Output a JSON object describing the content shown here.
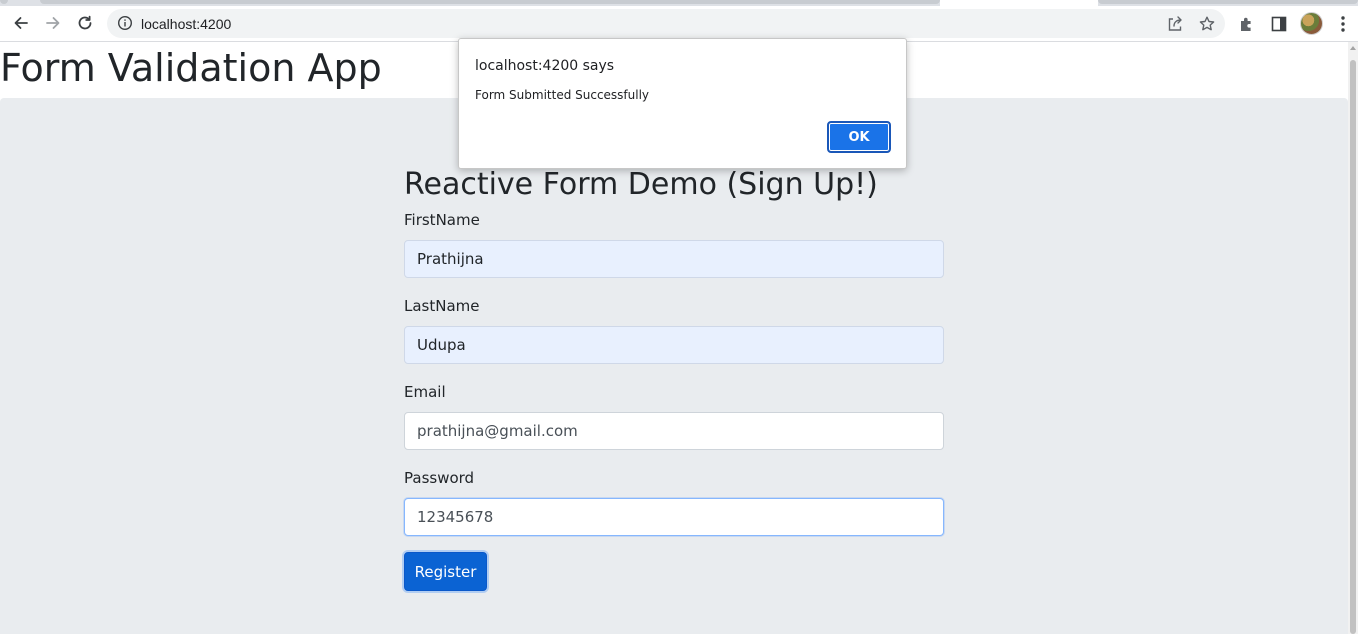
{
  "browser": {
    "url": "localhost:4200"
  },
  "page": {
    "app_title": "Form Validation App",
    "form_title": "Reactive Form Demo (Sign Up!)",
    "fields": [
      {
        "label": "FirstName",
        "value": "Prathijna"
      },
      {
        "label": "LastName",
        "value": "Udupa"
      },
      {
        "label": "Email",
        "value": "prathijna@gmail.com"
      },
      {
        "label": "Password",
        "value": "12345678"
      }
    ],
    "register_label": "Register"
  },
  "dialog": {
    "origin": "localhost:4200 says",
    "message": "Form Submitted Successfully",
    "ok_label": "OK"
  },
  "colors": {
    "panel_background": "#e9ecef",
    "primary_button": "#0b63d3",
    "dialog_ok": "#1a73e8",
    "autofill_background": "#e8f0fe"
  },
  "icons": {
    "back": "back-arrow-icon",
    "forward": "forward-arrow-icon",
    "reload": "reload-icon",
    "site_info": "info-icon",
    "share": "share-icon",
    "bookmark": "star-icon",
    "extensions": "puzzle-icon",
    "side_panel": "side-panel-icon",
    "menu": "kebab-menu-icon"
  }
}
